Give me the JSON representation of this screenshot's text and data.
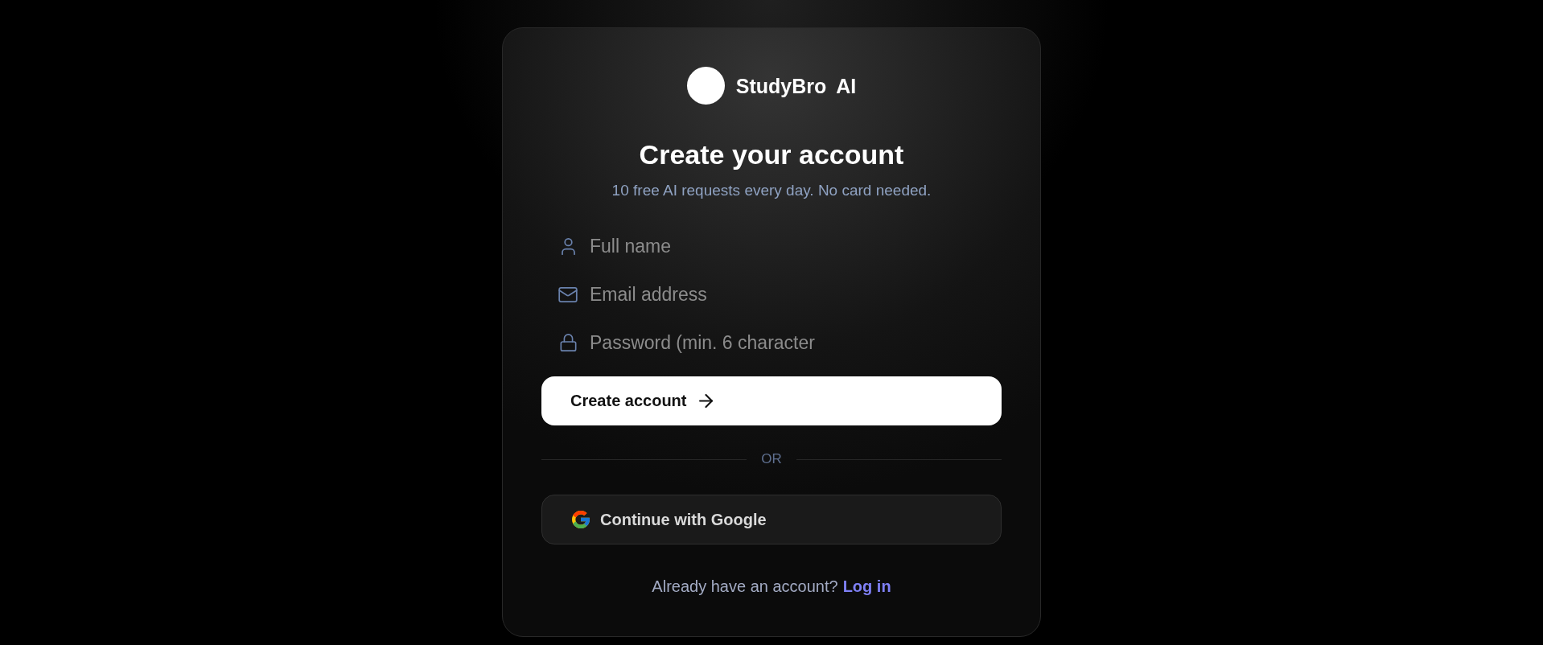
{
  "brand": {
    "name": "StudyBro",
    "suffix": "AI"
  },
  "heading": {
    "title": "Create your account",
    "subtitle": "10 free AI requests every day. No card needed."
  },
  "fields": [
    {
      "kind": "name",
      "placeholder": "Full name"
    },
    {
      "kind": "email",
      "placeholder": "Email address"
    },
    {
      "kind": "password",
      "placeholder": "Password (min. 6 character"
    }
  ],
  "primary_button": {
    "label": "Create account"
  },
  "divider": {
    "label": "OR"
  },
  "google_button": {
    "label": "Continue with Google"
  },
  "footer": {
    "text": "Already have an account?",
    "link": "Log in"
  }
}
